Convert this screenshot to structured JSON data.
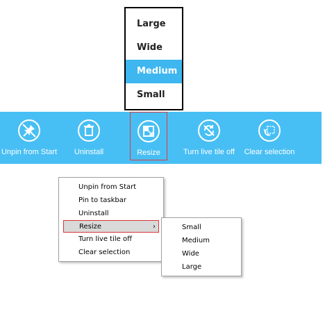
{
  "size_flyout": {
    "options": [
      "Large",
      "Wide",
      "Medium",
      "Small"
    ],
    "selected": "Medium"
  },
  "app_bar": {
    "background": "#48bff4",
    "commands": [
      {
        "label": "Unpin from Start",
        "icon": "unpin-icon"
      },
      {
        "label": "Uninstall",
        "icon": "trash-icon"
      },
      {
        "label": "Resize",
        "icon": "resize-icon"
      },
      {
        "label": "Turn live tile off",
        "icon": "live-tile-off-icon"
      },
      {
        "label": "Clear selection",
        "icon": "clear-selection-icon"
      }
    ]
  },
  "context_menu": {
    "items": [
      "Unpin from Start",
      "Pin to taskbar",
      "Uninstall",
      "Resize",
      "Turn live tile off",
      "Clear selection"
    ],
    "highlighted": "Resize",
    "submenu_arrow": "›"
  },
  "resize_submenu": {
    "items": [
      "Small",
      "Medium",
      "Wide",
      "Large"
    ]
  }
}
